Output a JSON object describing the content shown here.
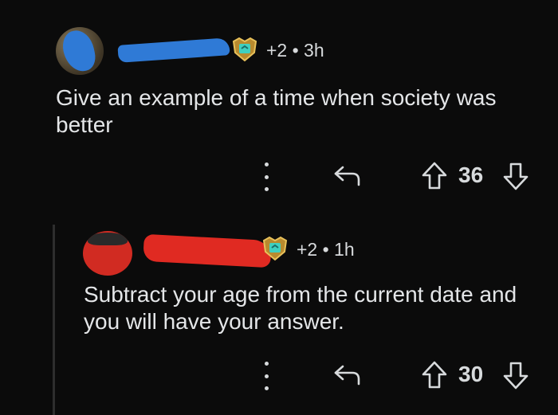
{
  "comments": [
    {
      "author": "",
      "meta": "+2 • 3h",
      "body": "Give an example of a time when society was better",
      "score": "36"
    },
    {
      "author": "",
      "meta": "+2 • 1h",
      "body": "Subtract your age from the current date and you will have your answer.",
      "score": "30"
    }
  ],
  "icons": {
    "badge": "award-badge-icon",
    "more": "more-vertical-icon",
    "reply": "reply-arrow-icon",
    "upvote": "upvote-arrow-icon",
    "downvote": "downvote-arrow-icon"
  },
  "colors": {
    "background": "#0b0b0b",
    "text": "#d7dadc",
    "redaction_blue": "#2f7ad6",
    "redaction_red": "#e02a22"
  }
}
